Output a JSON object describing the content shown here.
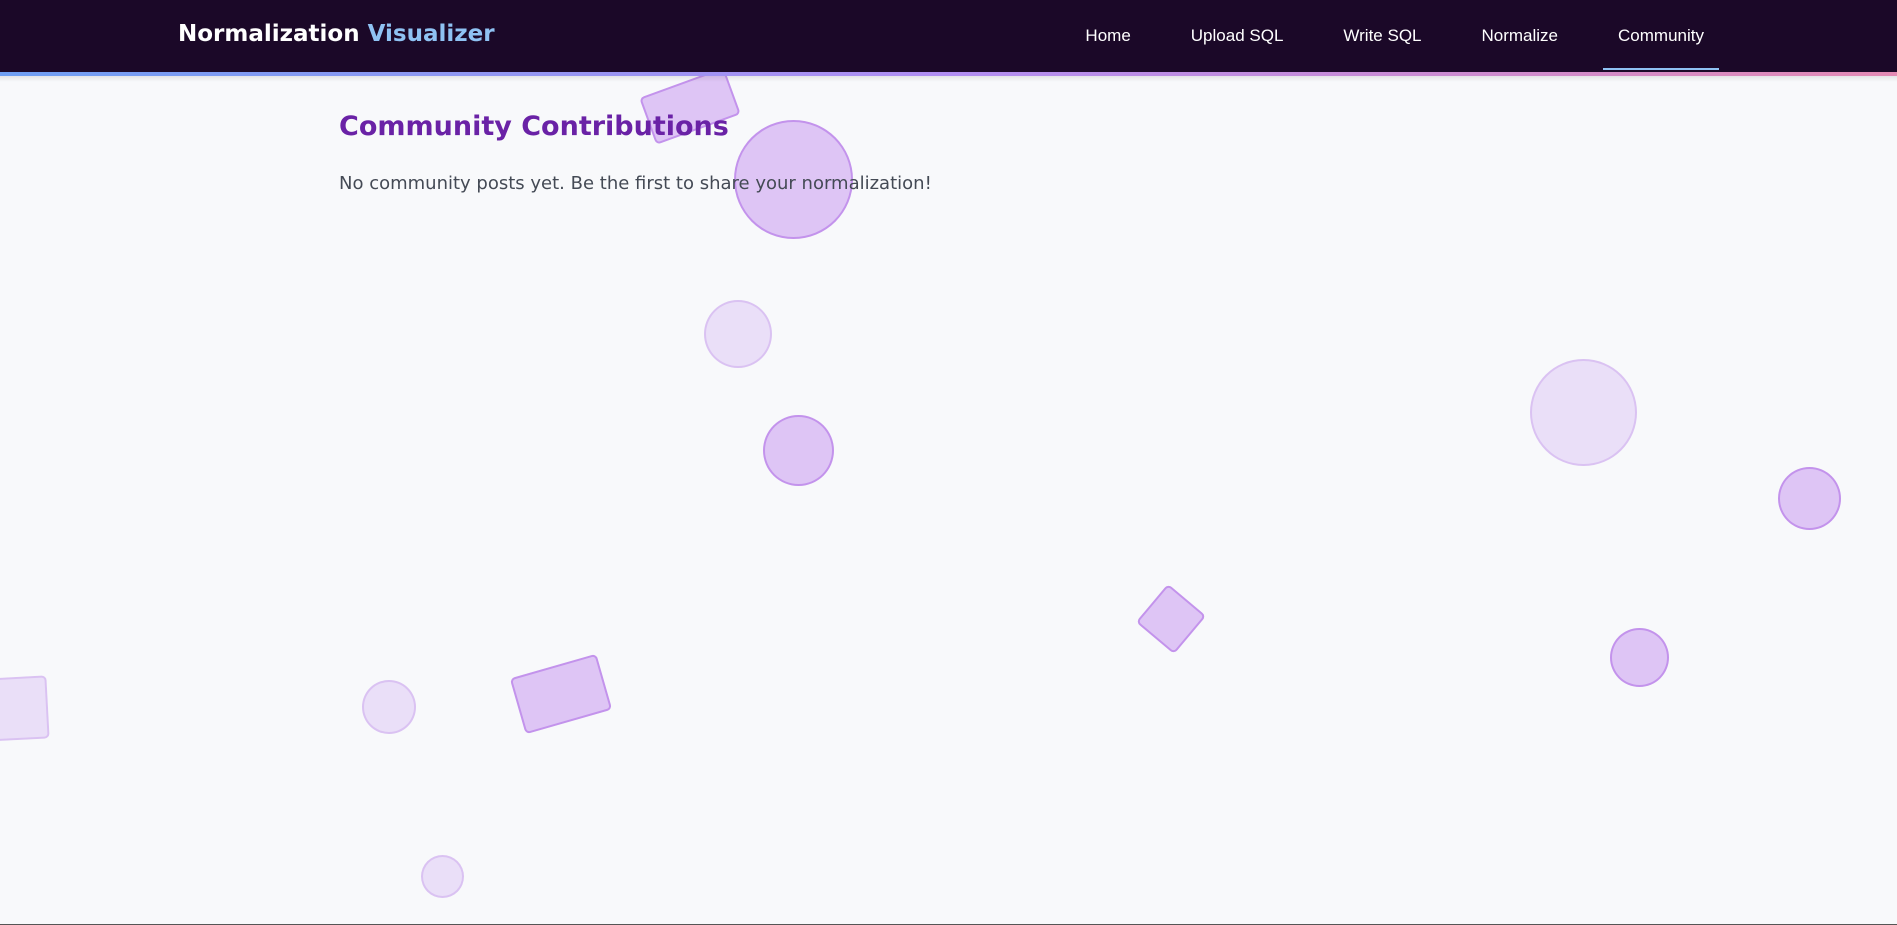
{
  "app": {
    "brand_primary": "Normalization",
    "brand_accent": "Visualizer",
    "colors": {
      "nav_bg": "#1b0828",
      "brand_accent": "#8fc2f3",
      "title": "#6a22a6",
      "page_bg": "#f8f9fb"
    }
  },
  "nav": {
    "items": [
      {
        "label": "Home"
      },
      {
        "label": "Upload SQL"
      },
      {
        "label": "Write SQL"
      },
      {
        "label": "Normalize"
      },
      {
        "label": "Community"
      }
    ],
    "active": "Community"
  },
  "main": {
    "title": "Community Contributions",
    "empty_message": "No community posts yet. Be the first to share your normalization!"
  }
}
